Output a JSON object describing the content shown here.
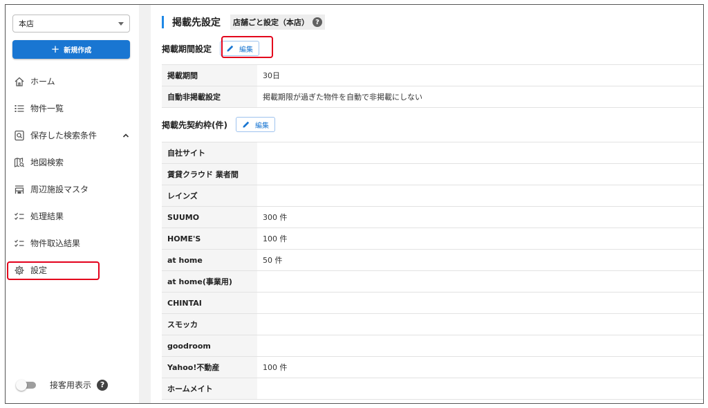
{
  "sidebar": {
    "store_select": "本店",
    "create_button": "新規作成",
    "items": [
      {
        "label": "ホーム",
        "icon": "home-icon"
      },
      {
        "label": "物件一覧",
        "icon": "list-icon"
      },
      {
        "label": "保存した検索条件",
        "icon": "saved-search-icon"
      },
      {
        "label": "地図検索",
        "icon": "map-search-icon"
      },
      {
        "label": "周辺施設マスタ",
        "icon": "facility-icon"
      },
      {
        "label": "処理結果",
        "icon": "checklist-icon"
      },
      {
        "label": "物件取込結果",
        "icon": "checklist-icon"
      },
      {
        "label": "設定",
        "icon": "gear-icon"
      }
    ],
    "toggle_label": "接客用表示",
    "help": "?"
  },
  "header": {
    "title": "掲載先設定",
    "scope": "店舗ごと設定（本店）",
    "help": "?"
  },
  "period_section": {
    "title": "掲載期間設定",
    "edit_label": "編集",
    "rows": [
      {
        "key": "掲載期間",
        "value": "30日"
      },
      {
        "key": "自動非掲載設定",
        "value": "掲載期限が過ぎた物件を自動で非掲載にしない"
      }
    ]
  },
  "quota_section": {
    "title": "掲載先契約枠(件)",
    "edit_label": "編集",
    "rows": [
      {
        "key": "自社サイト",
        "value": ""
      },
      {
        "key": "賃貸クラウド 業者間",
        "value": ""
      },
      {
        "key": "レインズ",
        "value": ""
      },
      {
        "key": "SUUMO",
        "value": "300 件"
      },
      {
        "key": "HOME'S",
        "value": "100 件"
      },
      {
        "key": "at home",
        "value": "50 件"
      },
      {
        "key": "at home(事業用)",
        "value": ""
      },
      {
        "key": "CHINTAI",
        "value": ""
      },
      {
        "key": "スモッカ",
        "value": ""
      },
      {
        "key": "goodroom",
        "value": ""
      },
      {
        "key": "Yahoo!不動産",
        "value": "100 件"
      },
      {
        "key": "ホームメイト",
        "value": ""
      }
    ]
  },
  "colors": {
    "primary": "#1976d2",
    "highlight": "#e3001b",
    "title_accent": "#1e88e5"
  }
}
